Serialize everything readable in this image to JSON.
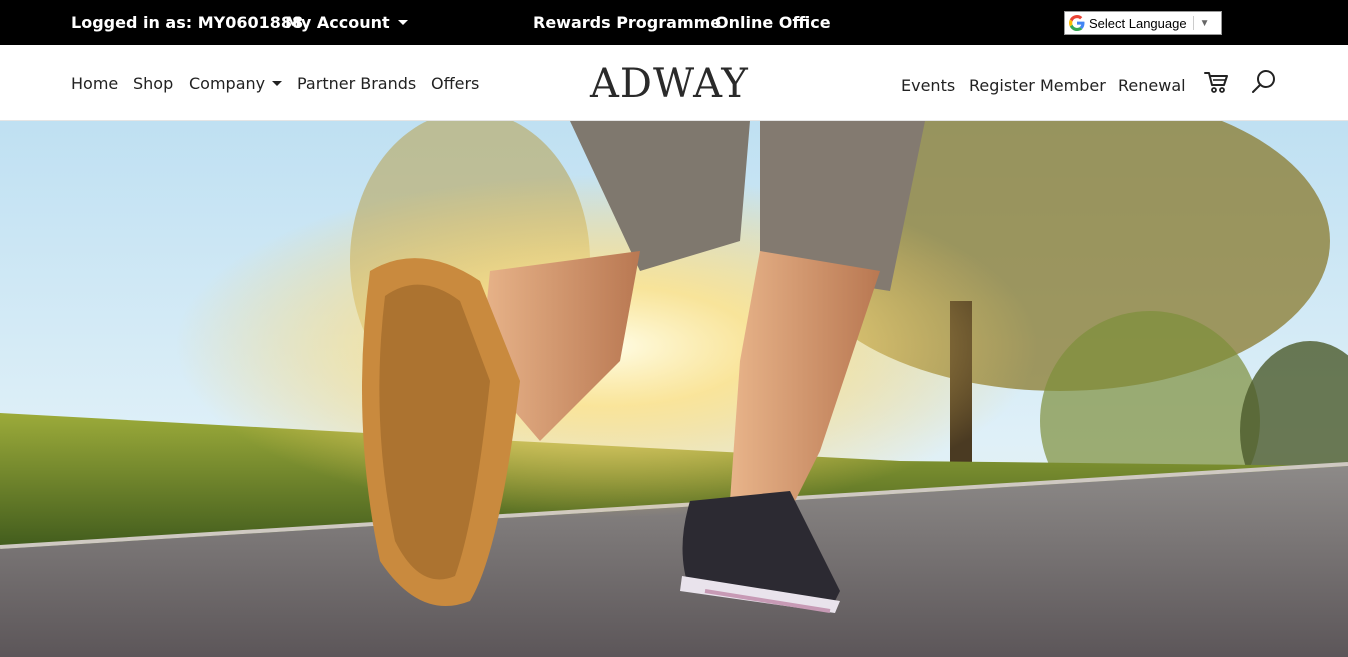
{
  "topbar": {
    "logged_in_text": "Logged in as: MY0601888",
    "my_account": "My Account",
    "rewards": "Rewards Programme",
    "online_office": "Online Office",
    "language_select": "Select Language"
  },
  "nav": {
    "left": [
      "Home",
      "Shop",
      "Company",
      "Partner Brands",
      "Offers"
    ],
    "brand": "ADWAY",
    "right": [
      "Events",
      "Register Member",
      "Renewal"
    ]
  },
  "icons": {
    "language": "google-g-icon",
    "cart": "cart-icon",
    "search": "search-icon"
  },
  "colors": {
    "topbar_bg": "#000000",
    "nav_text": "#222222",
    "logo": "#2a2a2a"
  }
}
